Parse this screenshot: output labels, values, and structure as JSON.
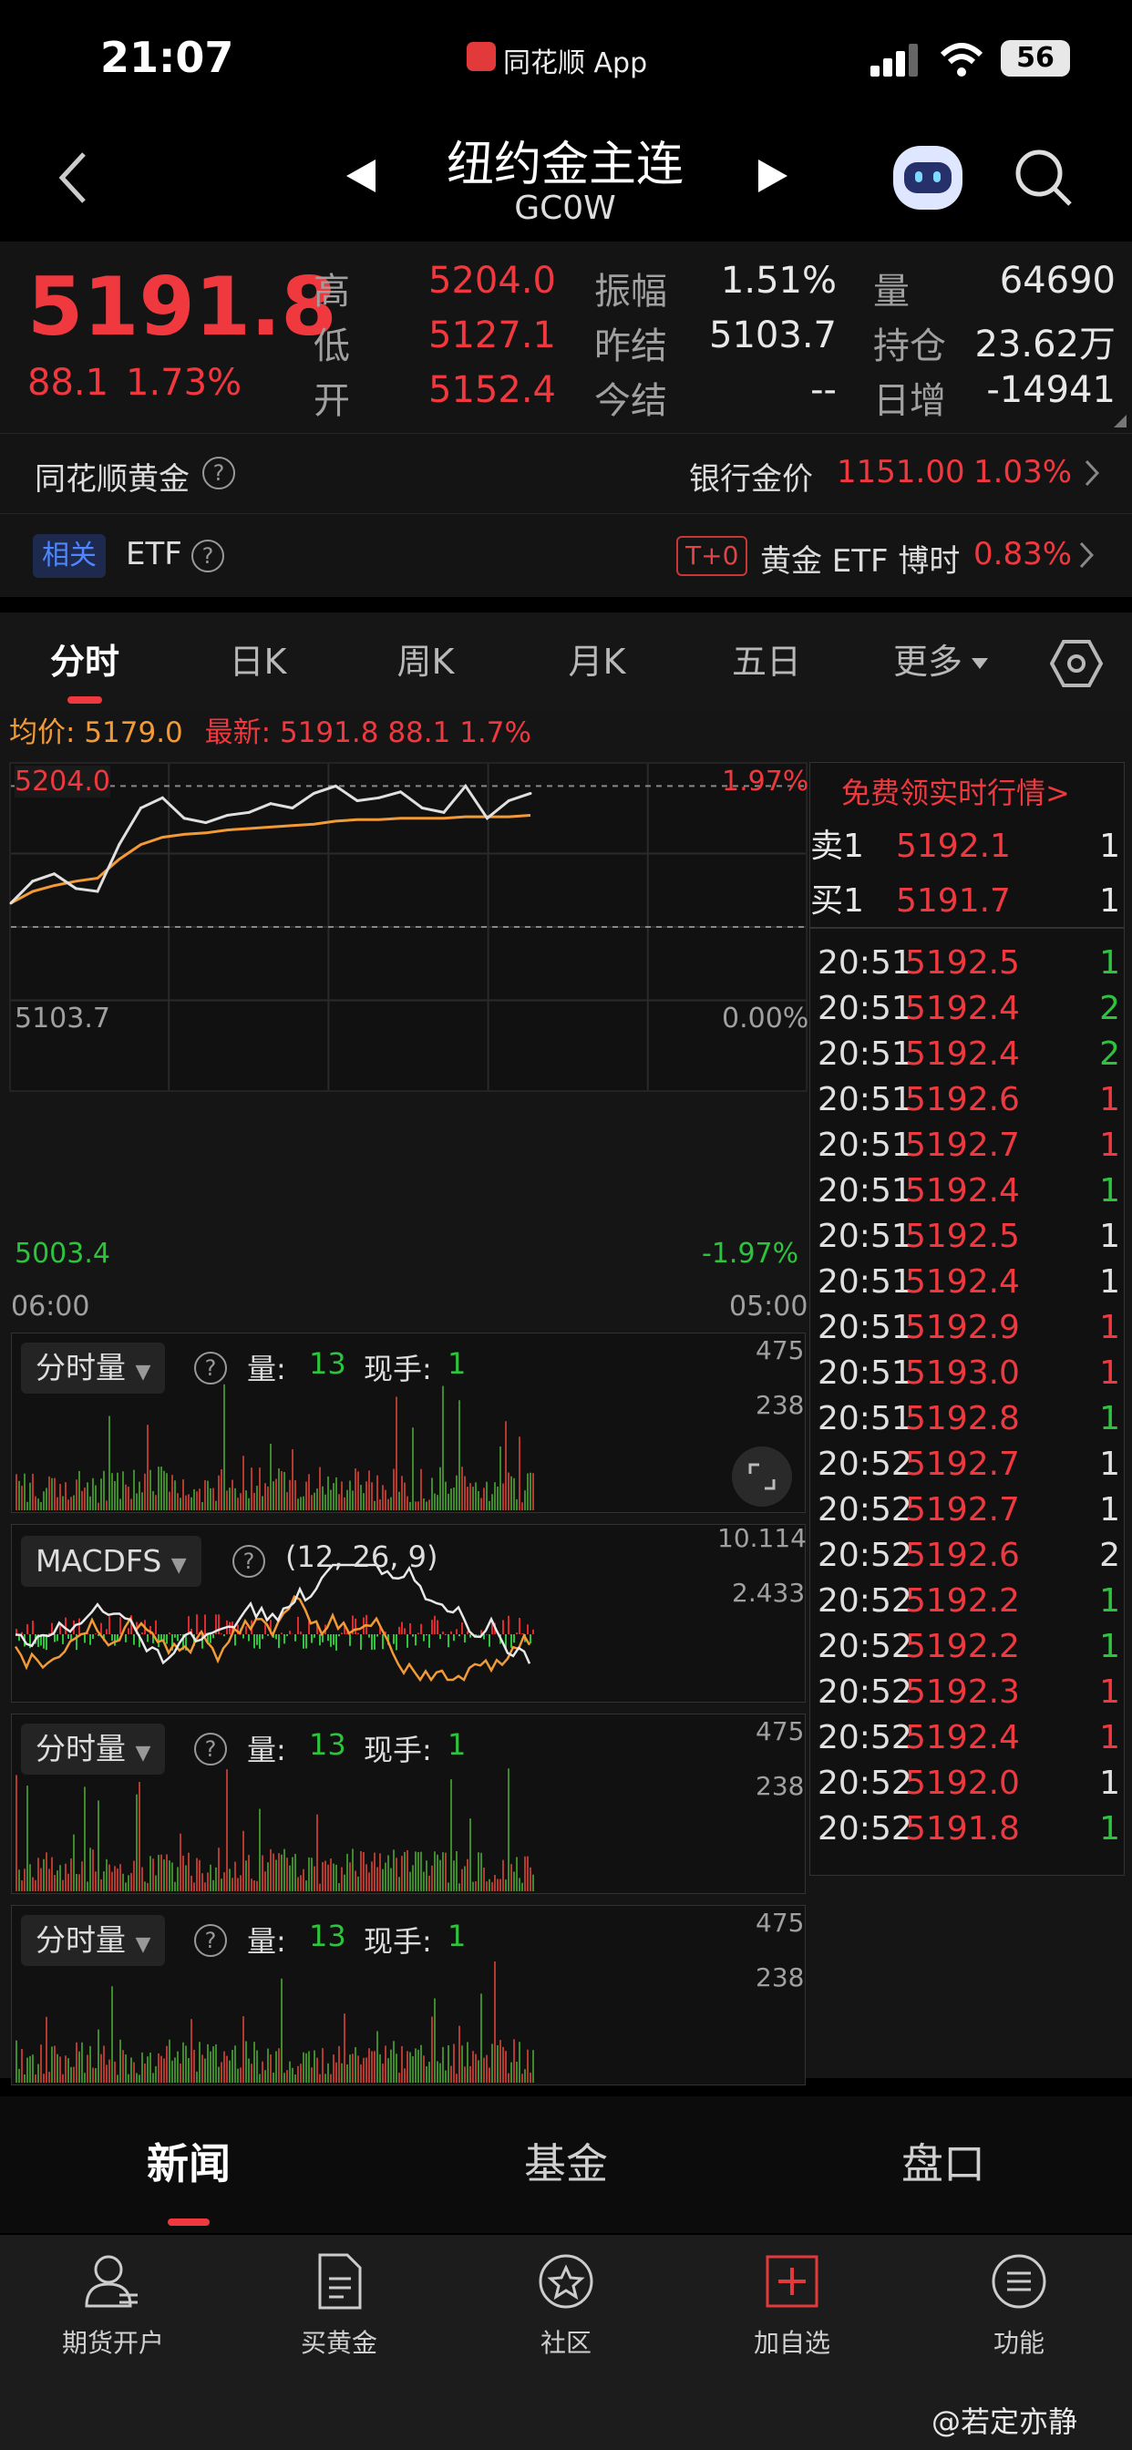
{
  "status": {
    "time": "21:07",
    "center_app": "同花顺 App",
    "battery": "56"
  },
  "nav": {
    "title": "纽约金主连",
    "code": "GC0W"
  },
  "quote": {
    "price": "5191.8",
    "change": "88.1",
    "pct": "1.73%",
    "high_label": "高",
    "high": "5204.0",
    "low_label": "低",
    "low": "5127.1",
    "open_label": "开",
    "open": "5152.4",
    "amp_label": "振幅",
    "amp": "1.51%",
    "prev_label": "昨结",
    "prev": "5103.7",
    "today_label": "今结",
    "today": "--",
    "vol_label": "量",
    "vol": "64690",
    "oi_label": "持仓",
    "oi": "23.62万",
    "daily_label": "日增",
    "daily": "-14941"
  },
  "gold_row": {
    "label": "同花顺黄金",
    "bank_label": "银行金价",
    "bank_price": "1151.00",
    "bank_pct": "1.03%"
  },
  "etf_row": {
    "tag": "相关",
    "label": "ETF",
    "t0": "T+0",
    "etf_name": "黄金 ETF 博时",
    "etf_pct": "0.83%"
  },
  "tabs": [
    {
      "label": "分时"
    },
    {
      "label": "日K"
    },
    {
      "label": "周K"
    },
    {
      "label": "月K"
    },
    {
      "label": "五日"
    },
    {
      "label": "更多"
    }
  ],
  "chart_info": {
    "avg_label": "均价:",
    "avg": "5179.0",
    "last_label": "最新:",
    "last": "5191.8",
    "chg": "88.1",
    "pct": "1.7%"
  },
  "chart_data": {
    "type": "line",
    "ylim": [
      5003.4,
      5204.0
    ],
    "y_tick_labels": [
      "5204.0",
      "5103.7",
      "5003.4"
    ],
    "right_tick_labels": [
      "1.97%",
      "0.00%",
      "-1.97%"
    ],
    "x_tick_labels": [
      "06:00",
      "05:00"
    ],
    "x": [
      0,
      5,
      10,
      15,
      20,
      25,
      30,
      35,
      40,
      45,
      50,
      55,
      60,
      65,
      70,
      75,
      80,
      85,
      90,
      95,
      100,
      105,
      110,
      115,
      120
    ],
    "series": [
      {
        "values": [
          5120,
          5135,
          5140,
          5130,
          5128,
          5160,
          5185,
          5192,
          5178,
          5175,
          5180,
          5182,
          5188,
          5185,
          5195,
          5200,
          5190,
          5192,
          5196,
          5185,
          5182,
          5200,
          5178,
          5190,
          5195
        ]
      },
      {
        "values": [
          5120,
          5128,
          5132,
          5135,
          5137,
          5150,
          5160,
          5165,
          5167,
          5168,
          5170,
          5171,
          5172,
          5173,
          5174,
          5176,
          5177,
          5177,
          5178,
          5178,
          5178,
          5179,
          5179,
          5179,
          5180
        ]
      }
    ]
  },
  "free_link": "免费领实时行情>",
  "book": [
    {
      "side": "卖1",
      "price": "5192.1",
      "vol": "1"
    },
    {
      "side": "买1",
      "price": "5191.7",
      "vol": "1"
    }
  ],
  "ticks": [
    {
      "t": "20:51",
      "p": "5192.5",
      "v": "1",
      "c": "green"
    },
    {
      "t": "20:51",
      "p": "5192.4",
      "v": "2",
      "c": "green"
    },
    {
      "t": "20:51",
      "p": "5192.4",
      "v": "2",
      "c": "green"
    },
    {
      "t": "20:51",
      "p": "5192.6",
      "v": "1",
      "c": "red"
    },
    {
      "t": "20:51",
      "p": "5192.7",
      "v": "1",
      "c": "red"
    },
    {
      "t": "20:51",
      "p": "5192.4",
      "v": "1",
      "c": "green"
    },
    {
      "t": "20:51",
      "p": "5192.5",
      "v": "1",
      "c": "white"
    },
    {
      "t": "20:51",
      "p": "5192.4",
      "v": "1",
      "c": "white"
    },
    {
      "t": "20:51",
      "p": "5192.9",
      "v": "1",
      "c": "red"
    },
    {
      "t": "20:51",
      "p": "5193.0",
      "v": "1",
      "c": "red"
    },
    {
      "t": "20:51",
      "p": "5192.8",
      "v": "1",
      "c": "green"
    },
    {
      "t": "20:52",
      "p": "5192.7",
      "v": "1",
      "c": "white"
    },
    {
      "t": "20:52",
      "p": "5192.7",
      "v": "1",
      "c": "white"
    },
    {
      "t": "20:52",
      "p": "5192.6",
      "v": "2",
      "c": "white"
    },
    {
      "t": "20:52",
      "p": "5192.2",
      "v": "1",
      "c": "green"
    },
    {
      "t": "20:52",
      "p": "5192.2",
      "v": "1",
      "c": "green"
    },
    {
      "t": "20:52",
      "p": "5192.3",
      "v": "1",
      "c": "red"
    },
    {
      "t": "20:52",
      "p": "5192.4",
      "v": "1",
      "c": "red"
    },
    {
      "t": "20:52",
      "p": "5192.0",
      "v": "1",
      "c": "white"
    },
    {
      "t": "20:52",
      "p": "5191.8",
      "v": "1",
      "c": "green"
    }
  ],
  "vol_panel": {
    "label": "分时量",
    "q_label": "量:",
    "q": "13",
    "xs_label": "现手:",
    "xs": "1",
    "top": "475",
    "mid": "238"
  },
  "macd_panel": {
    "label": "MACDFS",
    "params": "(12, 26, 9)",
    "top": "10.114",
    "mid": "2.433"
  },
  "bottom_tabs": [
    {
      "label": "新闻"
    },
    {
      "label": "基金"
    },
    {
      "label": "盘口"
    }
  ],
  "bottom_nav": [
    {
      "label": "期货开户"
    },
    {
      "label": "买黄金"
    },
    {
      "label": "社区"
    },
    {
      "label": "加自选"
    },
    {
      "label": "功能"
    }
  ],
  "watermark": "@若定亦静",
  "colors": {
    "up": "#f0383f",
    "down": "#2dc33d",
    "avg_line": "#f29a36",
    "price_line": "#e0e0e0"
  }
}
